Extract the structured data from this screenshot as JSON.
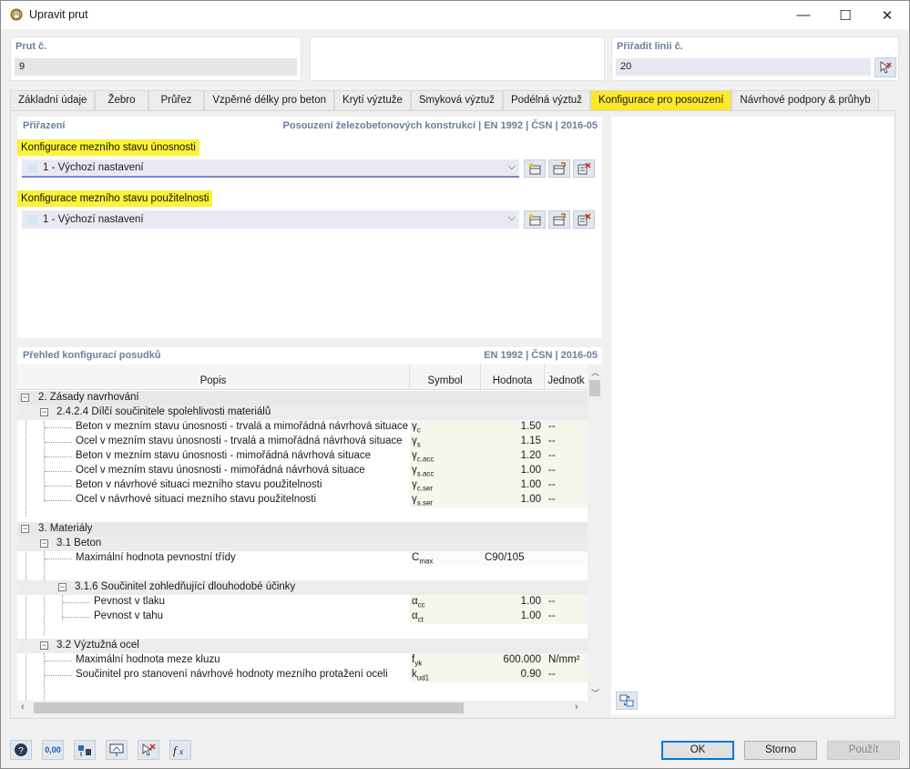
{
  "window": {
    "title": "Upravit prut",
    "minimize": "—",
    "maximize": "☐",
    "close": "✕"
  },
  "top": {
    "prut_label": "Prut č.",
    "prut_value": "9",
    "linie_label": "Přiřadit linii č.",
    "linie_value": "20"
  },
  "tabs": [
    {
      "label": "Základní údaje"
    },
    {
      "label": "Žebro"
    },
    {
      "label": "Průřez"
    },
    {
      "label": "Vzpěrné délky pro beton"
    },
    {
      "label": "Krytí výztuže"
    },
    {
      "label": "Smyková výztuž"
    },
    {
      "label": "Podélná výztuž"
    },
    {
      "label": "Konfigurace pro posouzení"
    },
    {
      "label": "Návrhové podpory & průhyb"
    }
  ],
  "assign": {
    "header": "Přiřazení",
    "standard": "Posouzení železobetonových konstrukcí | EN 1992 | ČSN | 2016-05",
    "uls_label": "Konfigurace mezního stavu únosnosti",
    "uls_value": "1 - Výchozí nastavení",
    "sls_label": "Konfigurace mezního stavu použitelnosti",
    "sls_value": "1 - Výchozí nastavení"
  },
  "overview": {
    "header": "Přehled konfigurací posudků",
    "standard": "EN 1992 | ČSN | 2016-05",
    "columns": {
      "popis": "Popis",
      "symbol": "Symbol",
      "hodnota": "Hodnota",
      "jednotka": "Jednotk"
    },
    "rows": [
      {
        "text": "2. Zásady navrhování"
      },
      {
        "text": "2.4.2.4 Dílčí součinitele spolehlivosti materiálů"
      },
      {
        "text": "Beton v mezním stavu únosnosti - trvalá a mimořádná návrhová situace",
        "sym": "γ",
        "sub": "c",
        "val": "1.50",
        "unit": "--"
      },
      {
        "text": "Ocel v mezním stavu únosnosti - trvalá a mimořádná návrhová situace",
        "sym": "γ",
        "sub": "s",
        "val": "1.15",
        "unit": "--"
      },
      {
        "text": "Beton v mezním stavu únosnosti - mimořádná návrhová situace",
        "sym": "γ",
        "sub": "c.acc",
        "val": "1.20",
        "unit": "--"
      },
      {
        "text": "Ocel v mezním stavu únosnosti - mimořádná návrhová situace",
        "sym": "γ",
        "sub": "s.acc",
        "val": "1.00",
        "unit": "--"
      },
      {
        "text": "Beton v návrhové situaci mezního stavu použitelnosti",
        "sym": "γ",
        "sub": "c.ser",
        "val": "1.00",
        "unit": "--"
      },
      {
        "text": "Ocel v návrhové situaci mezního stavu použitelnosti",
        "sym": "γ",
        "sub": "s.ser",
        "val": "1.00",
        "unit": "--"
      },
      {
        "text": "3. Materiály"
      },
      {
        "text": "3.1 Beton"
      },
      {
        "text": "Maximální hodnota pevnostní třídy",
        "sym": "C",
        "sub": "max",
        "val": "C90/105",
        "unit": ""
      },
      {
        "text": "3.1.6 Součinitel zohledňující dlouhodobé účinky"
      },
      {
        "text": "Pevnost v tlaku",
        "sym": "α",
        "sub": "cc",
        "val": "1.00",
        "unit": "--"
      },
      {
        "text": "Pevnost v tahu",
        "sym": "α",
        "sub": "ct",
        "val": "1.00",
        "unit": "--"
      },
      {
        "text": "3.2 Výztužná ocel"
      },
      {
        "text": "Maximální hodnota meze kluzu",
        "sym": "f",
        "sub": "yk",
        "val": "600.000",
        "unit": "N/mm²"
      },
      {
        "text": "Součinitel pro stanovení návrhové hodnoty mezního protažení oceli",
        "sym": "k",
        "sub": "ud1",
        "val": "0.90",
        "unit": "--"
      }
    ]
  },
  "buttons": {
    "ok": "OK",
    "cancel": "Storno",
    "apply": "Použít"
  },
  "bottom_icons": {
    "numbers": "0,00"
  },
  "colors": {
    "highlight": "#fbf23a",
    "active_tab": "#fde82a",
    "label_blue": "#6a7fa0"
  }
}
